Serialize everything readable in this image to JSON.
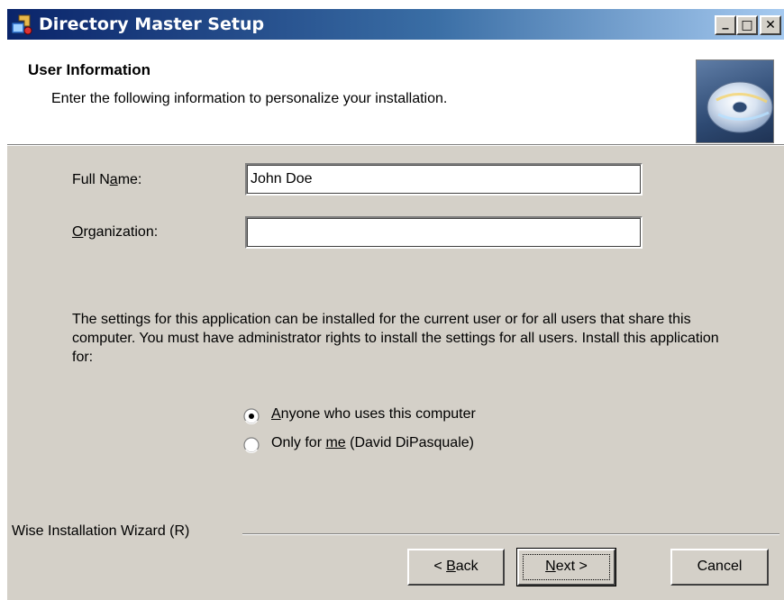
{
  "window": {
    "title": "Directory Master Setup",
    "controls": {
      "minimize": "_",
      "maximize": "□",
      "close": "✕"
    }
  },
  "header": {
    "title": "User Information",
    "subtitle": "Enter the following information to personalize your installation.",
    "icon": "cd-disc-icon"
  },
  "form": {
    "full_name": {
      "label_pre": "Full N",
      "label_accel": "a",
      "label_post": "me:",
      "value": "John Doe"
    },
    "organization": {
      "label_accel": "O",
      "label_post": "rganization:",
      "value": ""
    }
  },
  "install_info": "The settings for this application can be installed for the current user or for all users that share this computer. You must have administrator rights to install the settings for all users. Install this application for:",
  "install_for": {
    "selected": "anyone",
    "anyone": {
      "label_accel": "A",
      "label_post": "nyone who uses this computer"
    },
    "only_me": {
      "label_pre": "Only for ",
      "label_accel": "me",
      "label_post": " (David DiPasquale)"
    }
  },
  "footer": {
    "wizard_label": "Wise Installation Wizard (R)",
    "back": {
      "label_pre": "< ",
      "label_accel": "B",
      "label_post": "ack"
    },
    "next": {
      "label_accel": "N",
      "label_post": "ext >"
    },
    "cancel": "Cancel"
  },
  "colors": {
    "titlebar_start": "#0a246a",
    "titlebar_end": "#a6caf0",
    "dialog_face": "#d4d0c8"
  }
}
